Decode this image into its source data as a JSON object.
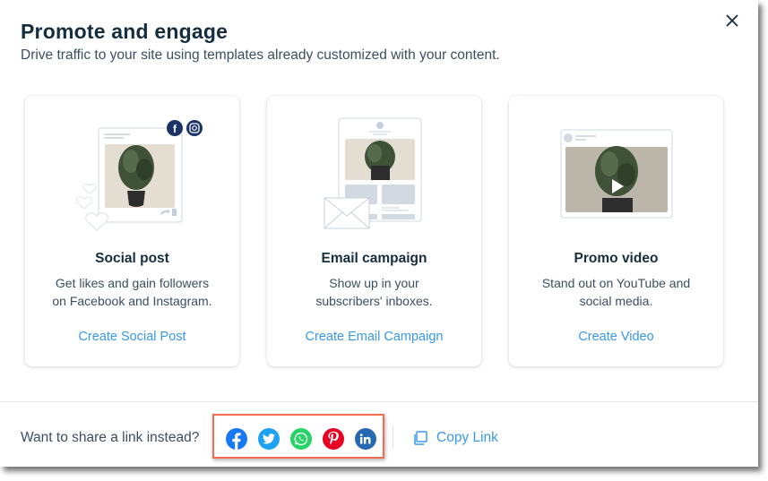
{
  "modal": {
    "title": "Promote and engage",
    "subtitle": "Drive traffic to your site using templates already customized with your content.",
    "close_icon": "close-icon"
  },
  "cards": [
    {
      "illustration": "social-post-illustration",
      "title": "Social post",
      "description_lines": [
        "Get likes and gain followers",
        "on Facebook and Instagram."
      ],
      "link_label": "Create Social Post"
    },
    {
      "illustration": "email-campaign-illustration",
      "title": "Email campaign",
      "description_lines": [
        "Show up in your",
        "subscribers' inboxes."
      ],
      "link_label": "Create Email Campaign"
    },
    {
      "illustration": "promo-video-illustration",
      "title": "Promo video",
      "description_lines": [
        "Stand out on YouTube and",
        "social media."
      ],
      "link_label": "Create Video"
    }
  ],
  "footer": {
    "share_label": "Want to share a link instead?",
    "share_networks": [
      {
        "name": "Facebook",
        "icon": "facebook-icon",
        "color": "#1877f2"
      },
      {
        "name": "Twitter",
        "icon": "twitter-icon",
        "color": "#1da1f2"
      },
      {
        "name": "WhatsApp",
        "icon": "whatsapp-icon",
        "color": "#25d366"
      },
      {
        "name": "Pinterest",
        "icon": "pinterest-icon",
        "color": "#e60023"
      },
      {
        "name": "LinkedIn",
        "icon": "linkedin-icon",
        "color": "#2867b2"
      }
    ],
    "copy_link_label": "Copy Link",
    "copy_icon": "copy-icon"
  },
  "colors": {
    "accent": "#3899ec",
    "heading": "#162d3d",
    "body_text": "#3b4e60",
    "highlight_border": "#f26c4f"
  }
}
